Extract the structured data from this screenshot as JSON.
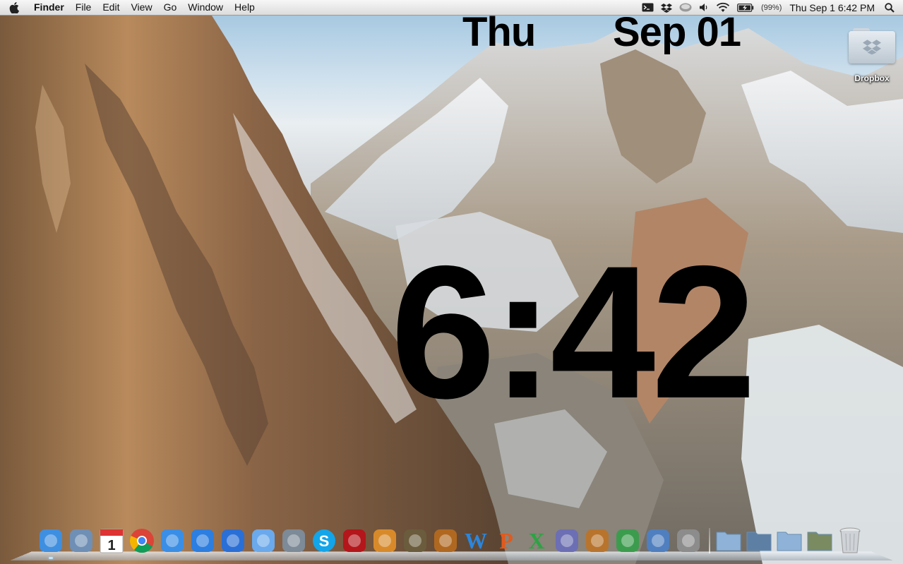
{
  "menubar": {
    "app_name": "Finder",
    "items": [
      "File",
      "Edit",
      "View",
      "Go",
      "Window",
      "Help"
    ],
    "status": {
      "icons": [
        "terminal-icon",
        "dropbox-icon",
        "time-machine-icon",
        "volume-icon",
        "wifi-icon",
        "battery-icon"
      ],
      "battery_percent": "(99%)",
      "datetime": "Thu Sep 1  6:42 PM"
    }
  },
  "desktop_clock": {
    "day": "Thu",
    "month_day": "Sep 01",
    "time": "6:42"
  },
  "desktop_icons": [
    {
      "label": "Dropbox",
      "icon": "dropbox-folder-icon"
    }
  ],
  "dock": {
    "apps": [
      {
        "name": "finder-icon",
        "color": "#3f8fe0",
        "running": true
      },
      {
        "name": "mail-icon",
        "color": "#6f8fb5",
        "running": false
      },
      {
        "name": "calendar-icon",
        "color": "#ffffff",
        "running": false
      },
      {
        "name": "chrome-icon",
        "color": "#dd4b39",
        "running": false
      },
      {
        "name": "safari-icon",
        "color": "#3a8ee6",
        "running": false
      },
      {
        "name": "app-store-icon",
        "color": "#2c7ee0",
        "running": false
      },
      {
        "name": "itunes-icon",
        "color": "#2a6fd6",
        "running": false
      },
      {
        "name": "messages-icon",
        "color": "#6aa9ec",
        "running": false
      },
      {
        "name": "facetime-icon",
        "color": "#7d8a97",
        "running": false
      },
      {
        "name": "skype-icon",
        "color": "#12a5ea",
        "running": false
      },
      {
        "name": "photo-booth-icon",
        "color": "#b3161b",
        "running": false
      },
      {
        "name": "iphoto-icon",
        "color": "#d88a2a",
        "running": false
      },
      {
        "name": "imovie-icon",
        "color": "#6a5c3c",
        "running": false
      },
      {
        "name": "garageband-icon",
        "color": "#b06820",
        "running": false
      },
      {
        "name": "word-icon",
        "color": "#2a86dd",
        "running": false
      },
      {
        "name": "powerpoint-icon",
        "color": "#e25a1c",
        "running": false
      },
      {
        "name": "excel-icon",
        "color": "#2da343",
        "running": false
      },
      {
        "name": "script-editor-icon",
        "color": "#6c6fb3",
        "running": false
      },
      {
        "name": "keynote-icon",
        "color": "#b8742d",
        "running": false
      },
      {
        "name": "numbers-icon",
        "color": "#3c9c4e",
        "running": false
      },
      {
        "name": "preview-icon",
        "color": "#4f7fbf",
        "running": false
      },
      {
        "name": "system-preferences-icon",
        "color": "#8c8c8c",
        "running": false
      }
    ],
    "stacks": [
      {
        "name": "applications-folder-icon",
        "color": "#8fb3d8"
      },
      {
        "name": "screenshots-stack-icon",
        "color": "#5e7fa4"
      },
      {
        "name": "documents-folder-icon",
        "color": "#8fb3d8"
      },
      {
        "name": "downloads-stack-icon",
        "color": "#7a8b62"
      },
      {
        "name": "trash-icon",
        "color": "#d0d4d8"
      }
    ]
  }
}
